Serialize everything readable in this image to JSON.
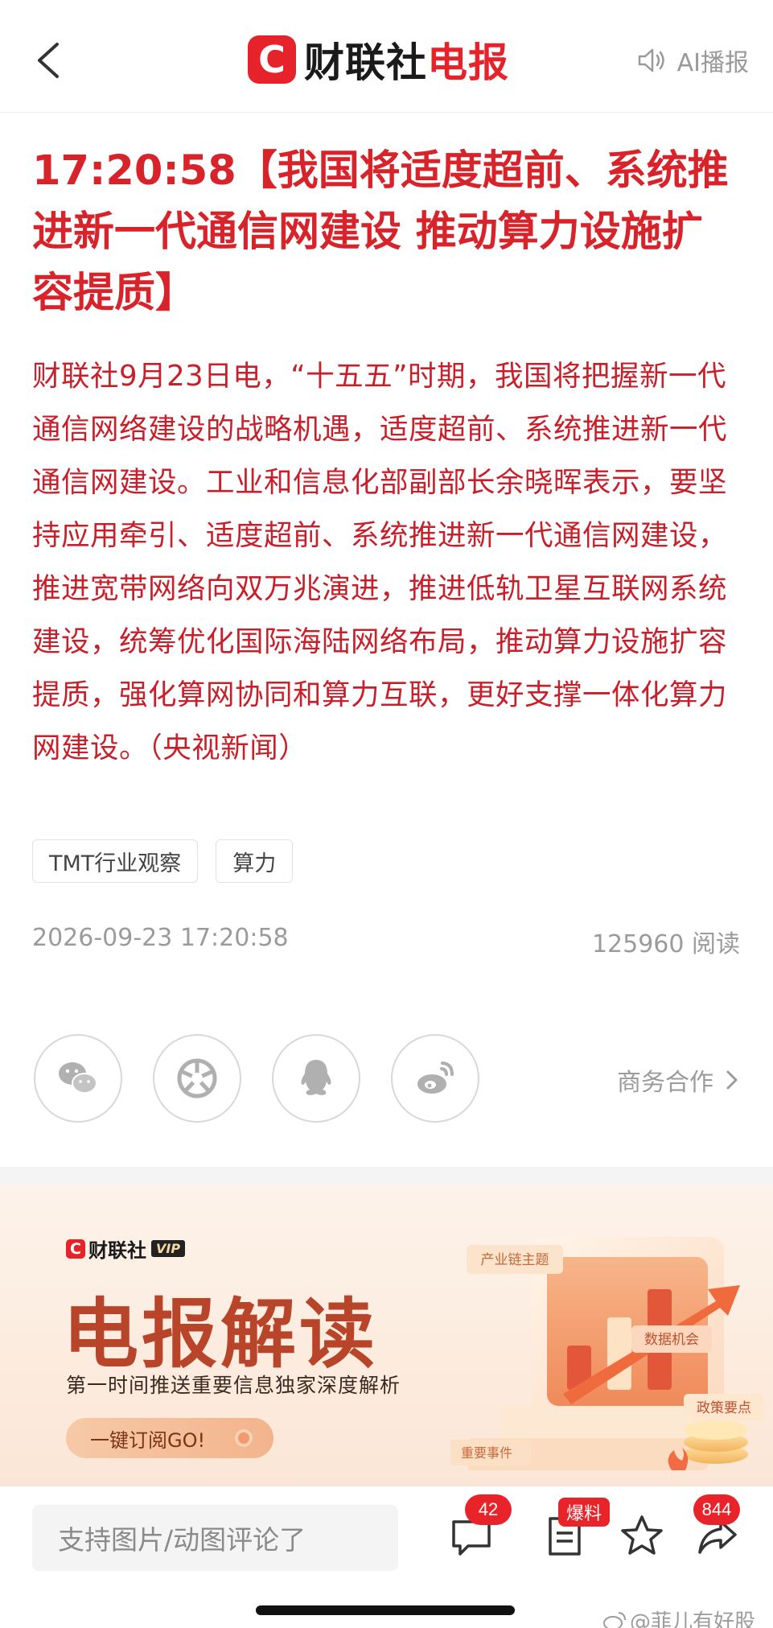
{
  "header": {
    "brand_logo_letter": "C",
    "brand_name": "财联社",
    "brand_sub": "电报",
    "ai_play_label": "AI播报"
  },
  "article": {
    "title": "17:20:58【我国将适度超前、系统推进新一代通信网建设 推动算力设施扩容提质】",
    "body": "财联社9月23日电，“十五五”时期，我国将把握新一代通信网络建设的战略机遇，适度超前、系统推进新一代通信网建设。工业和信息化部副部长余晓晖表示，要坚持应用牵引、适度超前、系统推进新一代通信网建设，推进宽带网络向双万兆演进，推进低轨卫星互联网系统建设，统筹优化国际海陆网络布局，推动算力设施扩容提质，强化算网协同和算力互联，更好支撑一体化算力网建设。（央视新闻）",
    "tags": [
      "TMT行业观察",
      "算力"
    ],
    "datetime": "2026-09-23 17:20:58",
    "reads": "125960 阅读"
  },
  "share": {
    "items": [
      "wechat-icon",
      "moments-icon",
      "qq-icon",
      "weibo-icon"
    ],
    "business_label": "商务合作"
  },
  "banner": {
    "brand": "财联社",
    "vip": "VIP",
    "title": "电报解读",
    "subtitle": "第一时间推送重要信息独家深度解析",
    "subscribe_label": "一键订阅GO!",
    "illus_labels": {
      "industry": "产业链主题",
      "data": "数据机会",
      "policy": "政策要点",
      "event": "重要事件"
    }
  },
  "bottom_bar": {
    "comment_placeholder": "支持图片/动图评论了",
    "comment_count": "42",
    "baoliao_label": "爆料",
    "share_count": "844",
    "watermark": "@菲儿有好股"
  },
  "colors": {
    "accent": "#e6232b",
    "title_red": "#d8232a",
    "body_red": "#c8202a",
    "banner_title": "#b8452a"
  }
}
